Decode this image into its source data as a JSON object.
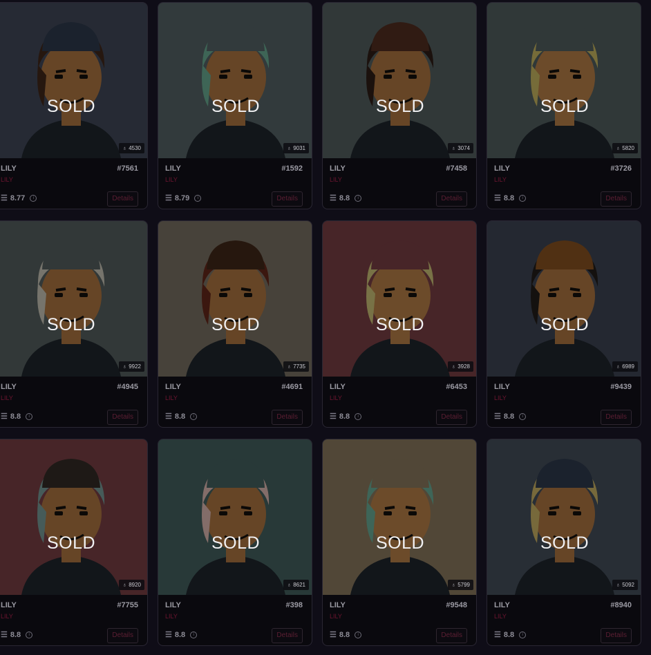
{
  "sold_label": "SOLD",
  "details_label": "Details",
  "cards": [
    {
      "name": "LILY",
      "collection": "LILY",
      "token": "#7561",
      "price": "8.77",
      "rank": "4530",
      "bg": "#3a4150",
      "hat": "#2a3545",
      "hair": "#3b2418",
      "skin": "#9c6a3a"
    },
    {
      "name": "LILY",
      "collection": "LILY",
      "token": "#1592",
      "price": "8.79",
      "rank": "9031",
      "bg": "#4c585b",
      "hat": "#4c585b",
      "hair": "#5e9a83",
      "skin": "#9c6a3a"
    },
    {
      "name": "LILY",
      "collection": "LILY",
      "token": "#7458",
      "price": "8.8",
      "rank": "3074",
      "bg": "#4b5556",
      "hat": "#4a2a1e",
      "hair": "#2a1a14",
      "skin": "#9c6a3a"
    },
    {
      "name": "LILY",
      "collection": "LILY",
      "token": "#3726",
      "price": "8.8",
      "rank": "5820",
      "bg": "#4a5556",
      "hat": "#4a5556",
      "hair": "#b3a457",
      "skin": "#a57240"
    },
    {
      "name": "LILY",
      "collection": "LILY",
      "token": "#4945",
      "price": "8.8",
      "rank": "9922",
      "bg": "#4c5656",
      "hat": "#4c5656",
      "hair": "#b3b0a4",
      "skin": "#9c6a3a"
    },
    {
      "name": "LILY",
      "collection": "LILY",
      "token": "#4691",
      "price": "8.8",
      "rank": "7735",
      "bg": "#6d6458",
      "hat": "#3b2416",
      "hair": "#5a2418",
      "skin": "#9c6a3a"
    },
    {
      "name": "LILY",
      "collection": "LILY",
      "token": "#6453",
      "price": "8.8",
      "rank": "3928",
      "bg": "#6d393e",
      "hat": "#6d393e",
      "hair": "#b7ad6b",
      "skin": "#a57240"
    },
    {
      "name": "LILY",
      "collection": "LILY",
      "token": "#9439",
      "price": "8.8",
      "rank": "6989",
      "bg": "#383e4b",
      "hat": "#7a4a1e",
      "hair": "#1f1a18",
      "skin": "#9c6a3a"
    },
    {
      "name": "LILY",
      "collection": "LILY",
      "token": "#7755",
      "price": "8.8",
      "rank": "8920",
      "bg": "#6d393e",
      "hat": "#2e2622",
      "hair": "#6b8a88",
      "skin": "#9c6a3a"
    },
    {
      "name": "LILY",
      "collection": "LILY",
      "token": "#398",
      "price": "8.8",
      "rank": "8621",
      "bg": "#3e5756",
      "hat": "#3e5756",
      "hair": "#c7a6a0",
      "skin": "#9c6a3a"
    },
    {
      "name": "LILY",
      "collection": "LILY",
      "token": "#9548",
      "price": "8.8",
      "rank": "5799",
      "bg": "#7b6d54",
      "hat": "#7b6d54",
      "hair": "#5e9a86",
      "skin": "#a57240"
    },
    {
      "name": "LILY",
      "collection": "LILY",
      "token": "#8940",
      "price": "8.8",
      "rank": "5092",
      "bg": "#3e4651",
      "hat": "#2a3545",
      "hair": "#b5a05a",
      "skin": "#9c6a3a"
    }
  ]
}
